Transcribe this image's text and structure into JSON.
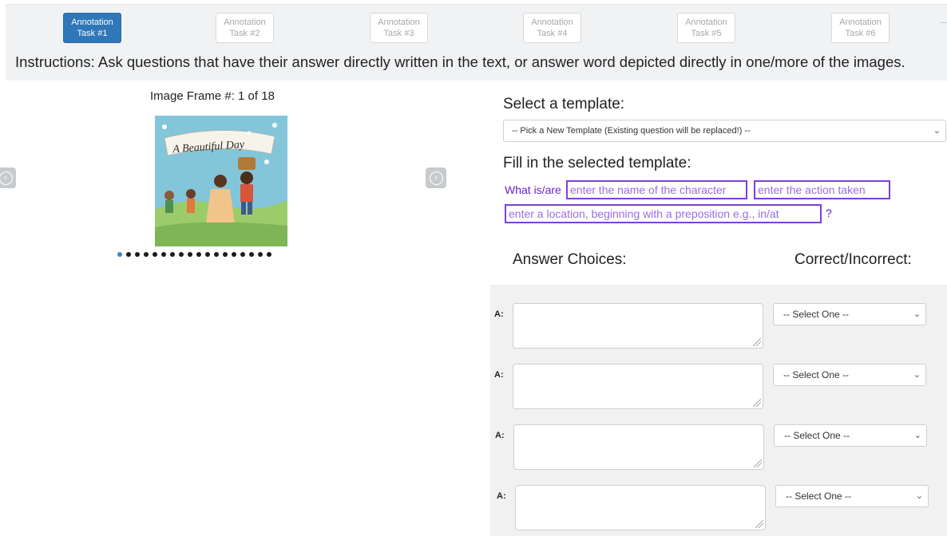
{
  "tabs": [
    {
      "line1": "Annotation",
      "line2": "Task #1",
      "active": true
    },
    {
      "line1": "Annotation",
      "line2": "Task #2",
      "active": false
    },
    {
      "line1": "Annotation",
      "line2": "Task #3",
      "active": false
    },
    {
      "line1": "Annotation",
      "line2": "Task #4",
      "active": false
    },
    {
      "line1": "Annotation",
      "line2": "Task #5",
      "active": false
    },
    {
      "line1": "Annotation",
      "line2": "Task #6",
      "active": false
    }
  ],
  "instructions": "Instructions: Ask questions that have their answer directly written in the text, or answer word depicted directly in one/more of the images.",
  "viewer": {
    "frame_label": "Image Frame #: 1 of 18",
    "cover_title": "A Beautiful Day",
    "dot_count": 18,
    "active_dot": 1
  },
  "template": {
    "heading": "Select a template:",
    "select_value": "-- Pick a New Template (Existing question will be replaced!) --",
    "fill_heading": "Fill in the selected template:",
    "prefix": "What is/are",
    "slot_character": "enter the name of the character",
    "slot_action": "enter the action taken",
    "slot_location": "enter a location, beginning with a preposition e.g., in/at",
    "suffix": "?"
  },
  "answers": {
    "heading": "Answer Choices:",
    "correct_heading": "Correct/Incorrect:",
    "rows": [
      {
        "label": "A:",
        "select": "-- Select One --"
      },
      {
        "label": "A:",
        "select": "-- Select One --"
      },
      {
        "label": "A:",
        "select": "-- Select One --"
      },
      {
        "label": "A:",
        "select": "-- Select One --"
      }
    ]
  },
  "colors": {
    "active_tab": "#2f77b9",
    "template_purple": "#7b3fe0",
    "active_dot": "#3b87c7"
  }
}
